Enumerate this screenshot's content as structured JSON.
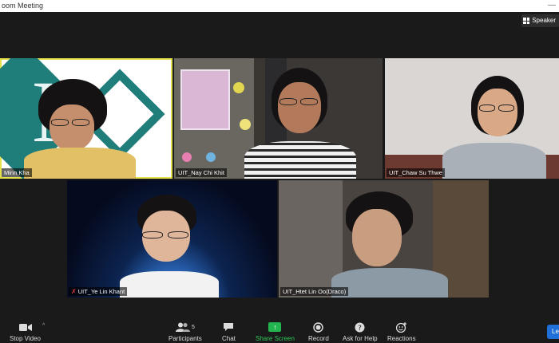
{
  "window": {
    "title": "oom Meeting",
    "controls": "—"
  },
  "view": {
    "label": "Speaker"
  },
  "participants": [
    {
      "name": "Minn Kha",
      "muted": false,
      "active": true
    },
    {
      "name": "UIT_Nay Chi Khit",
      "muted": false,
      "active": false
    },
    {
      "name": "UIT_Chaw Su Thwe",
      "muted": false,
      "active": false
    },
    {
      "name": "UIT_Ye Lin Khant",
      "muted": true,
      "active": false
    },
    {
      "name": "UIT_Htet Lin Oo(Draco)",
      "muted": false,
      "active": false
    }
  ],
  "toolbar": {
    "stop_video": "Stop Video",
    "participants": "Participants",
    "participants_count": "5",
    "chat": "Chat",
    "share_screen": "Share Screen",
    "record": "Record",
    "ask_for_help": "Ask for Help",
    "reactions": "Reactions",
    "leave": "Le"
  },
  "colors": {
    "active_speaker": "#e3e14c",
    "share_green": "#23b34f",
    "leave_blue": "#1e6fd9",
    "background": "#1a1a1a"
  }
}
